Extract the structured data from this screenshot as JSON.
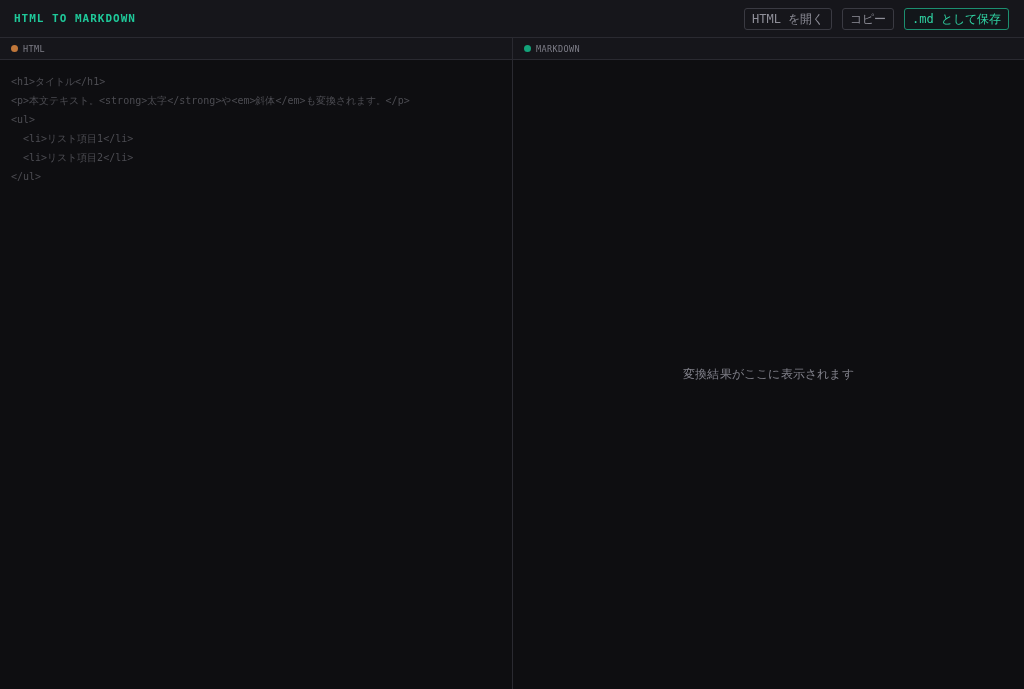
{
  "app": {
    "title": "HTML TO MARKDOWN"
  },
  "toolbar": {
    "buttons": [
      {
        "label": "HTML を開く",
        "primary": false
      },
      {
        "label": "コピー",
        "primary": false
      },
      {
        "label": ".md として保存",
        "primary": true
      }
    ]
  },
  "panes": [
    {
      "kind": "editor",
      "label": "HTML",
      "color": "#c0773a",
      "placeholder": "<h1>タイトル</h1>\n<p>本文テキスト。<strong>太字</strong>や<em>斜体</em>も変換されます。</p>\n<ul>\n  <li>リスト項目1</li>\n  <li>リスト項目2</li>\n</ul>"
    },
    {
      "kind": "output",
      "label": "MARKDOWN",
      "color": "#13a37a",
      "empty_text": "変換結果がここに表示されます"
    }
  ]
}
